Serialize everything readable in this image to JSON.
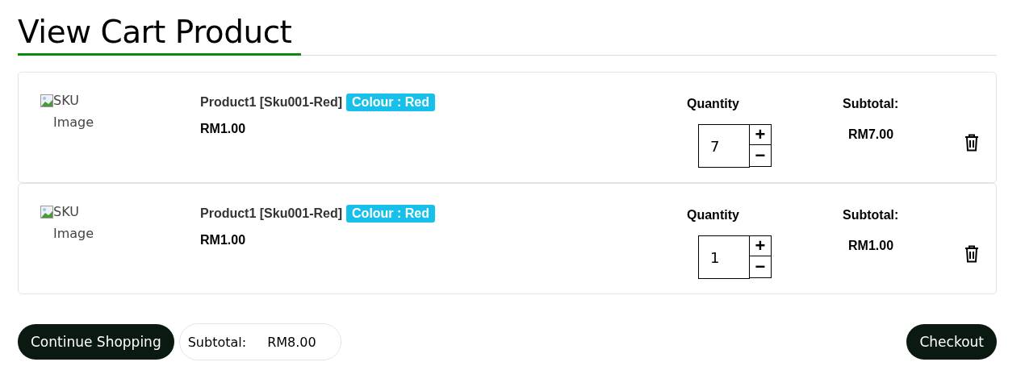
{
  "title": "View Cart Product",
  "items": [
    {
      "image_alt": "SKU Image",
      "name": "Product1 [Sku001-Red]",
      "variant": "Colour : Red",
      "price": "RM1.00",
      "quantity_label": "Quantity",
      "quantity": "7",
      "increase": "+",
      "decrease": "−",
      "subtotal_label": "Subtotal:",
      "subtotal": "RM7.00"
    },
    {
      "image_alt": "SKU Image",
      "name": "Product1 [Sku001-Red]",
      "variant": "Colour : Red",
      "price": "RM1.00",
      "quantity_label": "Quantity",
      "quantity": "1",
      "increase": "+",
      "decrease": "−",
      "subtotal_label": "Subtotal:",
      "subtotal": "RM1.00"
    }
  ],
  "footer": {
    "continue_button": "Continue Shopping",
    "subtotal_label": "Subtotal:",
    "subtotal": "RM8.00",
    "checkout_button": "Checkout"
  }
}
